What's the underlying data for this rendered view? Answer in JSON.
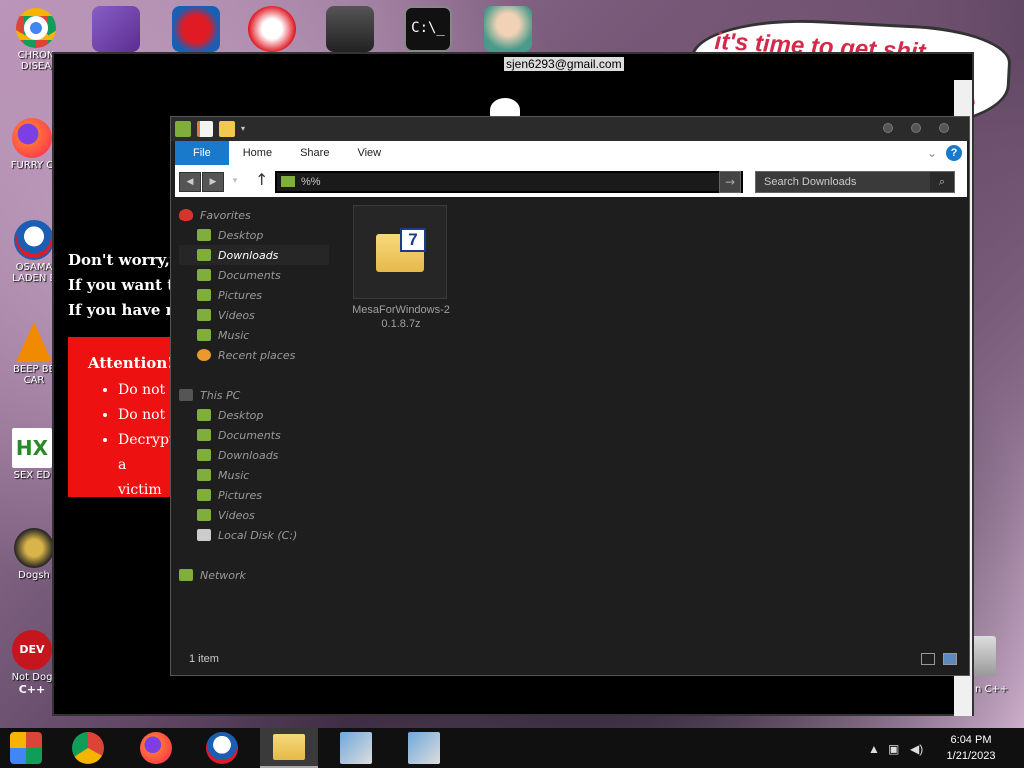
{
  "desktop": {
    "icons": [
      {
        "label": "CHRON DISEA"
      },
      {
        "label": "FURRY C"
      },
      {
        "label": "OSAMA LADEN E"
      },
      {
        "label": "BEEP BE CAR"
      },
      {
        "label": "SEX ED"
      },
      {
        "label": "Dogsh"
      },
      {
        "label": "Not Dog"
      }
    ],
    "right_icon_label": "n C++",
    "speech_text": "it's time to get shit",
    "speech_tail": "te"
  },
  "ransom": {
    "title": "sjen6293@gmail.com",
    "line1": "Don't worry,yo",
    "line2": "If you want to",
    "line3": "If you have no",
    "attention": "Attention!",
    "bullets": [
      "Do not r",
      "Do not t",
      "Decryptio"
    ],
    "bullet_cont": "a victim"
  },
  "explorer": {
    "ribbon": {
      "file": "File",
      "home": "Home",
      "share": "Share",
      "view": "View",
      "help": "?"
    },
    "address": "%%",
    "search_placeholder": "Search Downloads",
    "favorites": {
      "header": "Favorites",
      "items": [
        "Desktop",
        "Downloads",
        "Documents",
        "Pictures",
        "Videos",
        "Music",
        "Recent places"
      ]
    },
    "thispc": {
      "header": "This PC",
      "items": [
        "Desktop",
        "Documents",
        "Downloads",
        "Music",
        "Pictures",
        "Videos",
        "Local Disk (C:)"
      ]
    },
    "network": "Network",
    "file": {
      "name": "MesaForWindows-20.1.8.7z",
      "badge": "7"
    },
    "status": "1 item"
  },
  "taskbar": {
    "time": "6:04 PM",
    "date": "1/21/2023"
  },
  "colors": {
    "accent": "#1979ca",
    "ransom_red": "#ee1111"
  }
}
